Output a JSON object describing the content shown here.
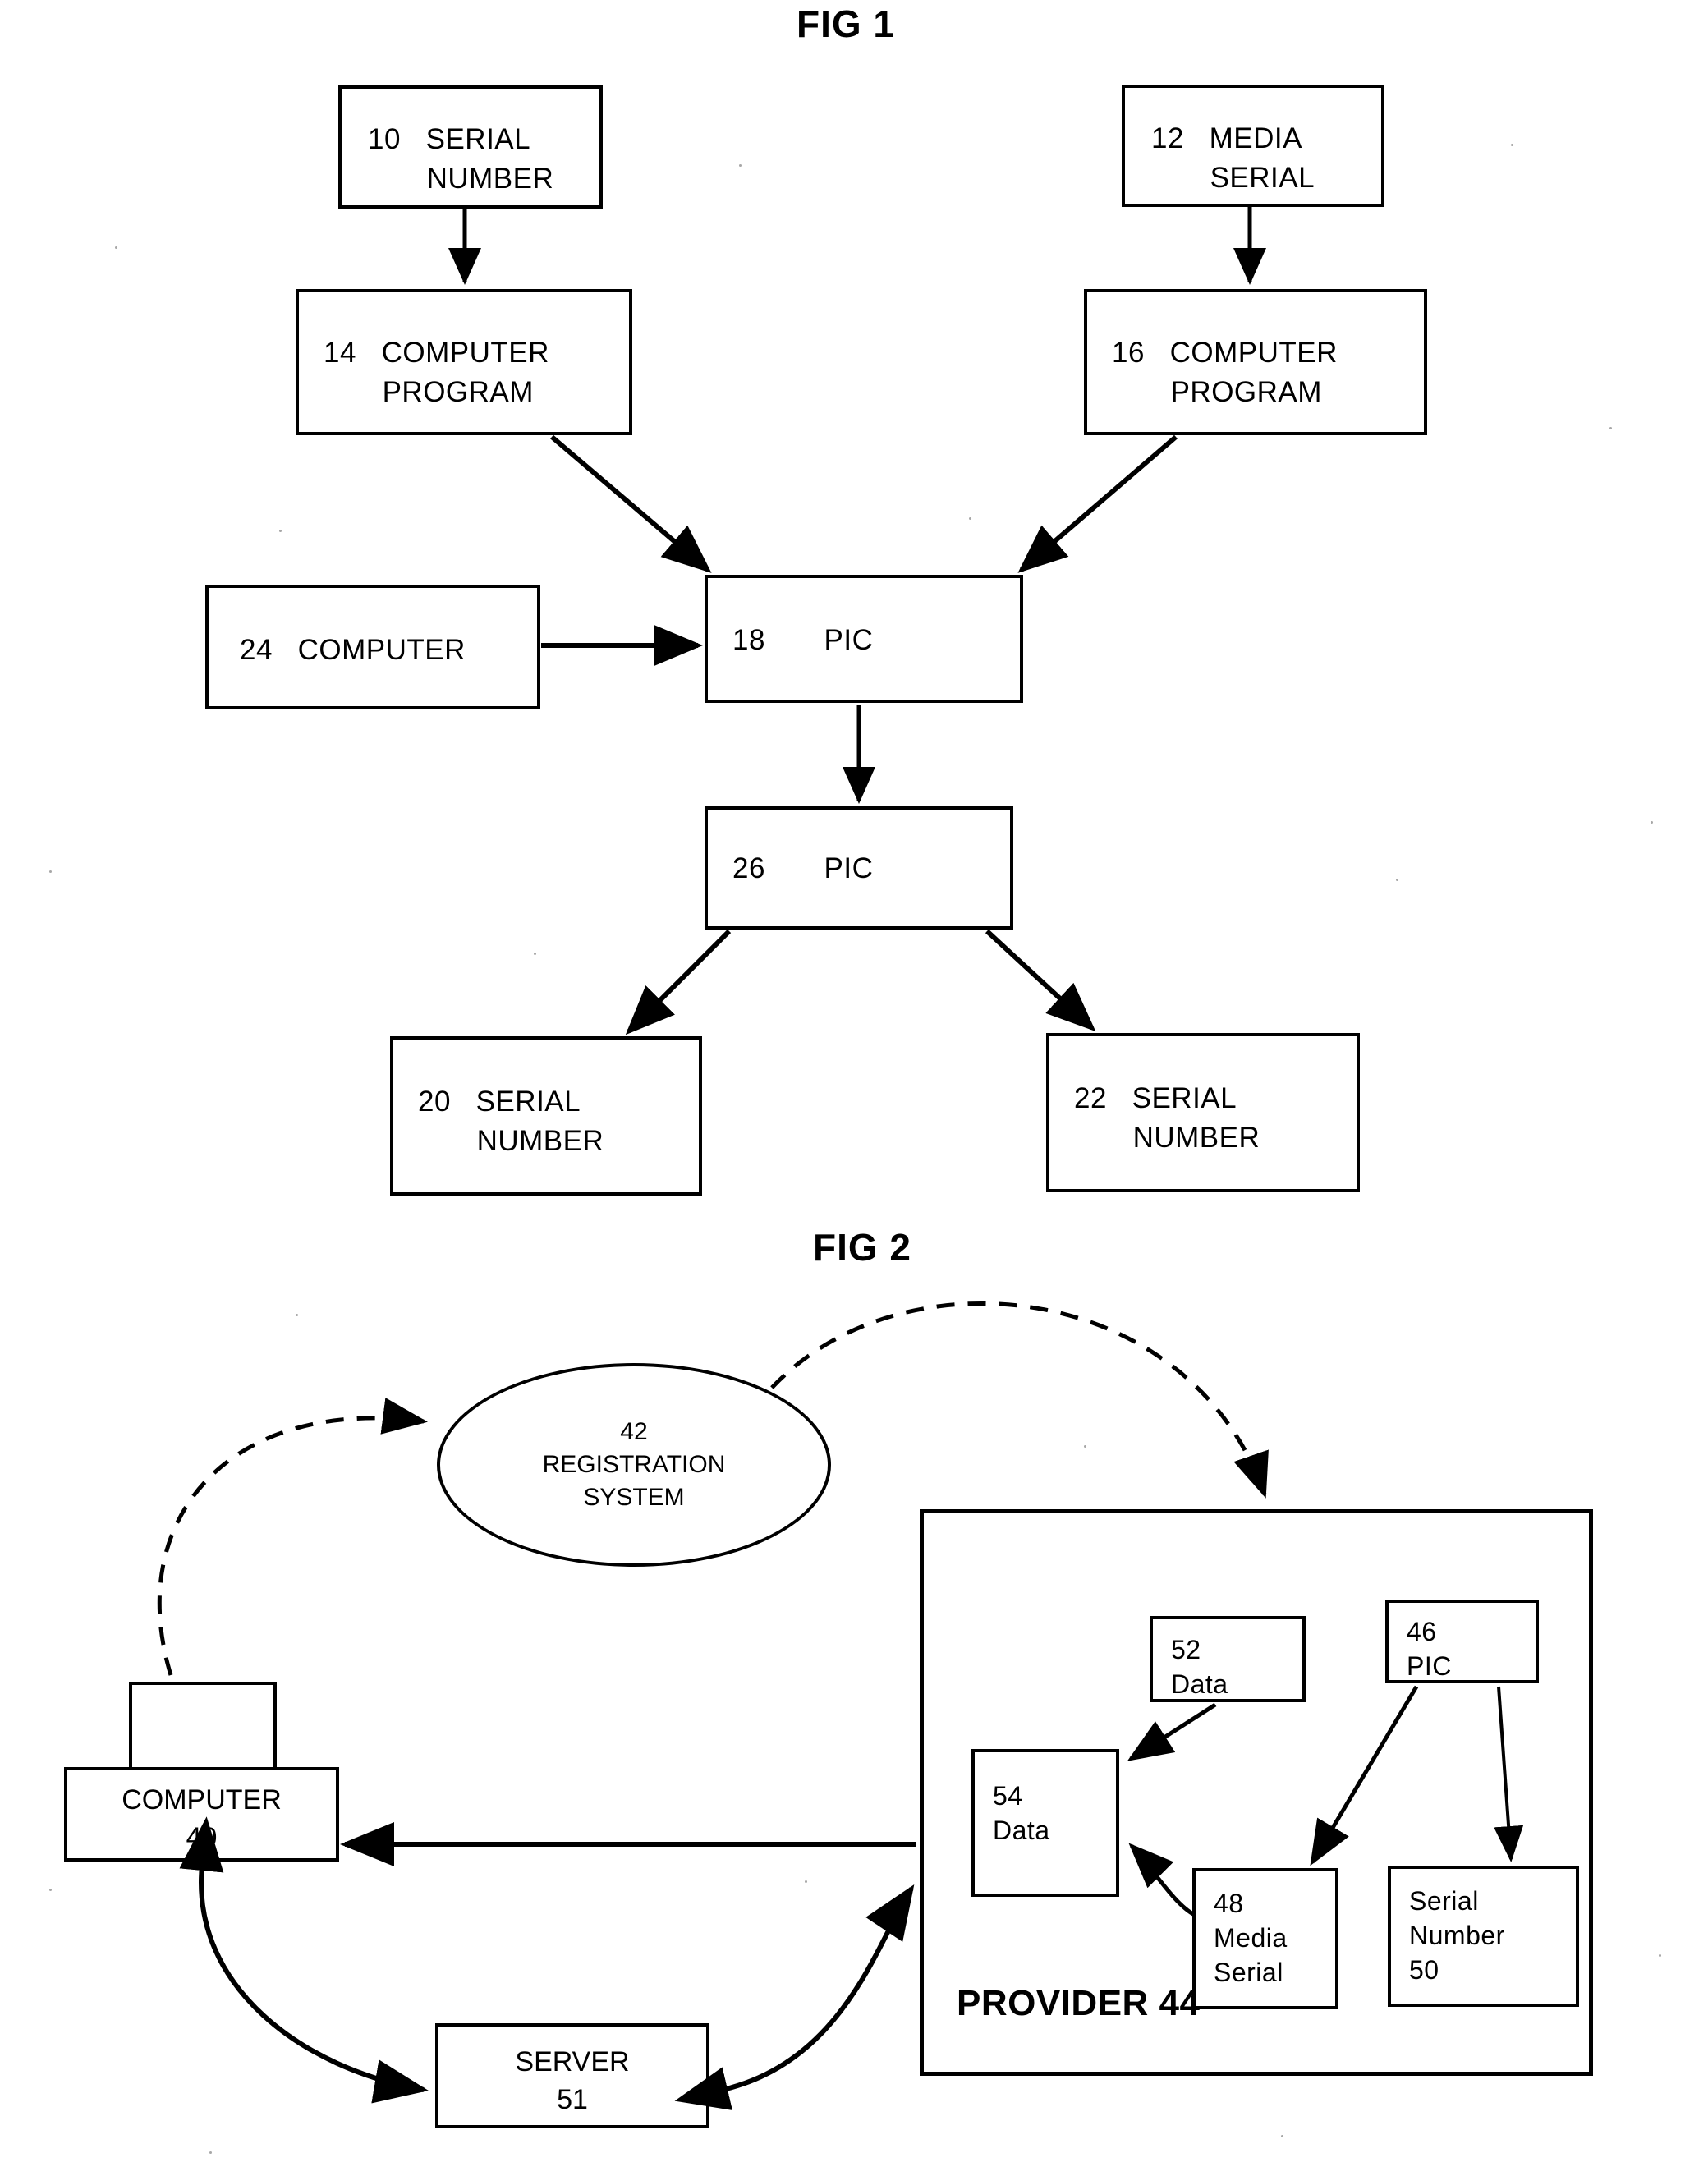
{
  "figures": [
    {
      "id": "fig1",
      "title": "FIG 1"
    },
    {
      "id": "fig2",
      "title": "FIG 2"
    }
  ],
  "fig1": {
    "title": "FIG 1",
    "nodes": [
      {
        "key": "n10",
        "ref": "10",
        "label": "SERIAL\nNUMBER",
        "text": "10   SERIAL\n       NUMBER"
      },
      {
        "key": "n12",
        "ref": "12",
        "label": "MEDIA\nSERIAL",
        "text": "12   MEDIA\n       SERIAL"
      },
      {
        "key": "n14",
        "ref": "14",
        "label": "COMPUTER\nPROGRAM",
        "text": "14   COMPUTER\n       PROGRAM"
      },
      {
        "key": "n16",
        "ref": "16",
        "label": "COMPUTER\nPROGRAM",
        "text": "16   COMPUTER\n       PROGRAM"
      },
      {
        "key": "n24",
        "ref": "24",
        "label": "COMPUTER",
        "text": "24   COMPUTER"
      },
      {
        "key": "n18",
        "ref": "18",
        "label": "PIC",
        "text": "18       PIC"
      },
      {
        "key": "n26",
        "ref": "26",
        "label": "PIC",
        "text": "26       PIC"
      },
      {
        "key": "n20",
        "ref": "20",
        "label": "SERIAL\nNUMBER",
        "text": "20   SERIAL\n       NUMBER"
      },
      {
        "key": "n22",
        "ref": "22",
        "label": "SERIAL\nNUMBER",
        "text": "22   SERIAL\n       NUMBER"
      }
    ],
    "edges": [
      {
        "from": "10",
        "to": "14",
        "style": "solid-arrow"
      },
      {
        "from": "12",
        "to": "16",
        "style": "solid-arrow"
      },
      {
        "from": "14",
        "to": "18",
        "style": "solid-arrow"
      },
      {
        "from": "16",
        "to": "18",
        "style": "solid-arrow"
      },
      {
        "from": "24",
        "to": "18",
        "style": "solid-arrow"
      },
      {
        "from": "18",
        "to": "26",
        "style": "solid-arrow"
      },
      {
        "from": "26",
        "to": "20",
        "style": "solid-arrow"
      },
      {
        "from": "26",
        "to": "22",
        "style": "solid-arrow"
      }
    ]
  },
  "fig2": {
    "title": "FIG 2",
    "registration_system": {
      "ref": "42",
      "text": "42\nREGISTRATION\nSYSTEM"
    },
    "computer": {
      "ref": "40",
      "text": "COMPUTER\n40"
    },
    "server": {
      "ref": "51",
      "text": "SERVER\n51"
    },
    "provider": {
      "ref": "44",
      "label": "PROVIDER 44"
    },
    "provider_nodes": [
      {
        "key": "n52",
        "ref": "52",
        "text": "52\nData"
      },
      {
        "key": "n46",
        "ref": "46",
        "text": "46\nPIC"
      },
      {
        "key": "n54",
        "ref": "54",
        "text": "54\nData"
      },
      {
        "key": "n48",
        "ref": "48",
        "text": "48\nMedia\nSerial"
      },
      {
        "key": "n50",
        "ref": "50",
        "text": "Serial\nNumber\n50"
      }
    ],
    "edges": [
      {
        "from": "40",
        "to": "42",
        "style": "dashed-curve-arrow"
      },
      {
        "from": "42",
        "to": "44",
        "style": "dashed-curve-arrow"
      },
      {
        "from": "44",
        "to": "40",
        "style": "solid-arrow"
      },
      {
        "from": "40",
        "to": "51",
        "style": "solid-curve-arrow-double"
      },
      {
        "from": "51",
        "to": "44",
        "style": "solid-curve-arrow-double"
      },
      {
        "from": "52",
        "to": "54",
        "style": "solid-arrow"
      },
      {
        "from": "48",
        "to": "54",
        "style": "solid-arrow"
      },
      {
        "from": "46",
        "to": "48",
        "style": "solid-arrow"
      },
      {
        "from": "46",
        "to": "50",
        "style": "solid-arrow"
      }
    ]
  },
  "colors": {
    "ink": "#000000",
    "paper": "#ffffff"
  }
}
